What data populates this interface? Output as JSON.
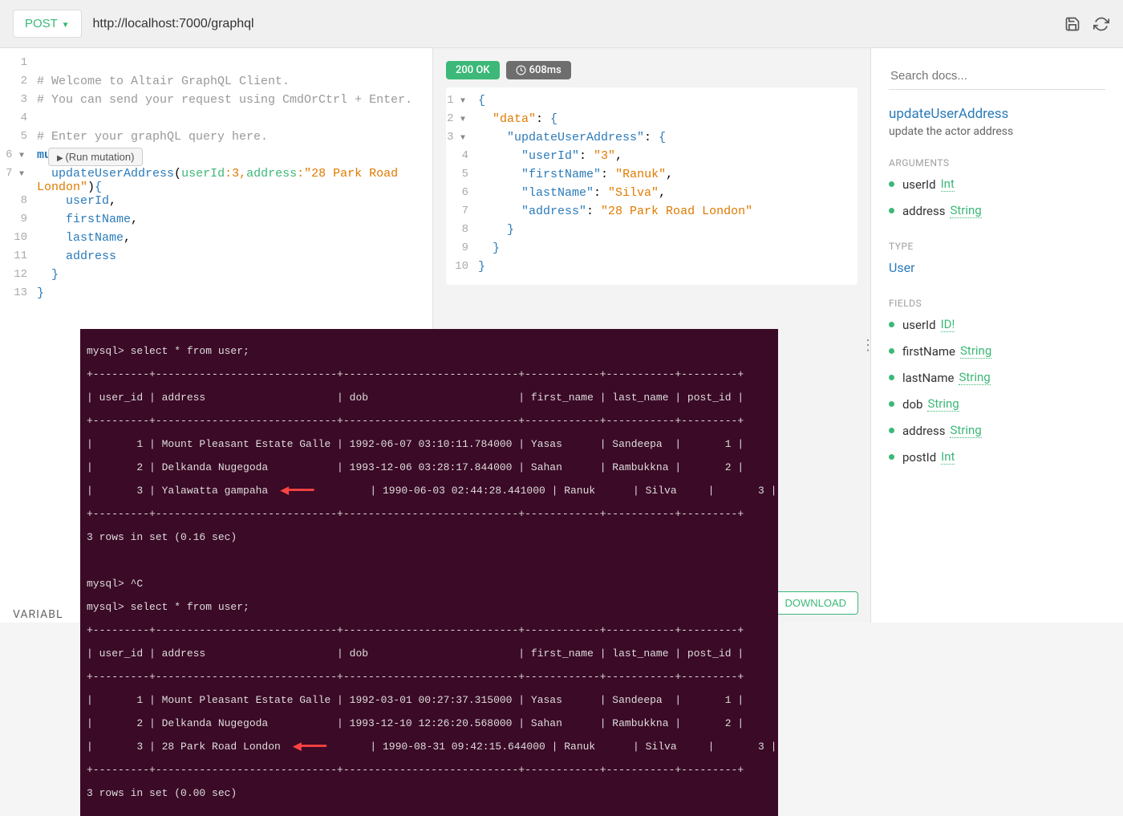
{
  "topbar": {
    "method": "POST",
    "url": "http://localhost:7000/graphql"
  },
  "request": {
    "lines": [
      {
        "n": "1",
        "c": ""
      },
      {
        "n": "2",
        "c": "# Welcome to Altair GraphQL Client."
      },
      {
        "n": "3",
        "c": "# You can send your request using CmdOrCtrl + Enter."
      },
      {
        "n": "4",
        "c": ""
      },
      {
        "n": "5",
        "c": "# Enter your graphQL query here."
      }
    ],
    "run_label": "(Run mutation)",
    "mutation_keyword": "mutation",
    "op": "updateUserAddress",
    "arg1_name": "userId",
    "arg1_val": "3",
    "arg2_name": "address",
    "arg2_val": "\"28 Park Road London\"",
    "fields": [
      "userId",
      "firstName",
      "lastName",
      "address"
    ]
  },
  "status": {
    "code": "200 OK",
    "time": "608ms"
  },
  "response": {
    "data_key": "\"data\"",
    "op_key": "\"updateUserAddress\"",
    "fields": [
      {
        "k": "\"userId\"",
        "v": "\"3\""
      },
      {
        "k": "\"firstName\"",
        "v": "\"Ranuk\""
      },
      {
        "k": "\"lastName\"",
        "v": "\"Silva\""
      },
      {
        "k": "\"address\"",
        "v": "\"28 Park Road London\""
      }
    ]
  },
  "docs": {
    "search_placeholder": "Search docs...",
    "title": "updateUserAddress",
    "desc": "update the actor address",
    "sections": {
      "arguments_label": "ARGUMENTS",
      "arguments": [
        {
          "name": "userId",
          "type": "Int"
        },
        {
          "name": "address",
          "type": "String"
        }
      ],
      "type_label": "TYPE",
      "type_value": "User",
      "fields_label": "FIELDS",
      "fields": [
        {
          "name": "userId",
          "type": "ID!"
        },
        {
          "name": "firstName",
          "type": "String"
        },
        {
          "name": "lastName",
          "type": "String"
        },
        {
          "name": "dob",
          "type": "String"
        },
        {
          "name": "address",
          "type": "String"
        },
        {
          "name": "postId",
          "type": "Int"
        }
      ]
    }
  },
  "terminal": {
    "prompt1": "mysql> select * from user;",
    "sep": "+---------+-----------------------------+----------------------------+------------+-----------+---------+",
    "hdr": "| user_id | address                     | dob                        | first_name | last_name | post_id |",
    "t1r1": "|       1 | Mount Pleasant Estate Galle | 1992-06-07 03:10:11.784000 | Yasas      | Sandeepa  |       1 |",
    "t1r2": "|       2 | Delkanda Nugegoda           | 1993-12-06 03:28:17.844000 | Sahan      | Rambukkna |       2 |",
    "t1r3a": "|       3 | Yalawatta gampaha  ",
    "t1r3b": "         | 1990-06-03 02:44:28.441000 | Ranuk      | Silva     |       3 |",
    "sum1": "3 rows in set (0.16 sec)",
    "ctrlc": "mysql> ^C",
    "prompt2": "mysql> select * from user;",
    "t2r1": "|       1 | Mount Pleasant Estate Galle | 1992-03-01 00:27:37.315000 | Yasas      | Sandeepa  |       1 |",
    "t2r2": "|       2 | Delkanda Nugegoda           | 1993-12-10 12:26:20.568000 | Sahan      | Rambukkna |       2 |",
    "t2r3a": "|       3 | 28 Park Road London  ",
    "t2r3b": "       | 1990-08-31 09:42:15.644000 | Ranuk      | Silva     |       3 |",
    "sum2": "3 rows in set (0.00 sec)"
  },
  "bottom": {
    "download": "DOWNLOAD",
    "variables": "VARIABL"
  }
}
